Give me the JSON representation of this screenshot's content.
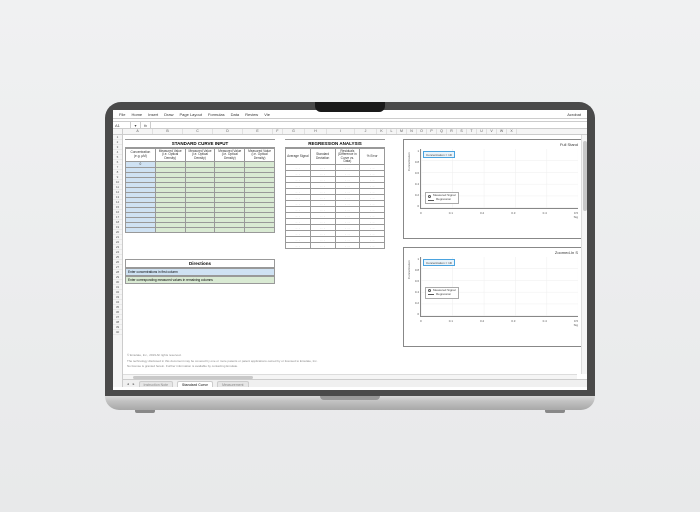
{
  "ribbon": {
    "tabs": [
      "File",
      "Home",
      "Insert",
      "Draw",
      "Page Layout",
      "Formulas",
      "Data",
      "Review",
      "Vie"
    ],
    "right": "Acrobat"
  },
  "formula_bar": {
    "name_box": "A1",
    "fx": "fx",
    "value": ""
  },
  "column_letters": [
    "A",
    "B",
    "C",
    "D",
    "E",
    "F",
    "G",
    "H",
    "I",
    "J",
    "K",
    "L",
    "M",
    "N",
    "O",
    "P",
    "Q",
    "R",
    "S",
    "T",
    "U",
    "V",
    "W",
    "X"
  ],
  "row_count": 40,
  "standard_curve": {
    "title": "STANDARD CURVE INPUT",
    "headers": [
      "Concentration (e.g. µM)",
      "Measured Value (i.e. Optical Density)",
      "Measured Value (i.e. Optical Density)",
      "Measured Value (i.e. Optical Density)",
      "Measured Value (i.e. Optical Density)"
    ],
    "first_cell": "0",
    "data_rows": 14
  },
  "regression": {
    "title": "REGRESSION ANALYSIS",
    "headers": [
      "Average Signal",
      "Standard Deviation",
      "Residuals (Difference in Curve vs. Data)",
      "% Error"
    ],
    "data_rows": 14
  },
  "directions": {
    "title": "Directions",
    "row1": "Enter concentrations in first column",
    "row2": "Enter corresponding measured values in remaining columns"
  },
  "chart_data": [
    {
      "type": "scatter",
      "title": "Full Stand",
      "annotation": "Concentration = 1D",
      "ylabel": "Concentration",
      "xlabel": "Sig",
      "series": [
        {
          "name": "Measured Signal",
          "x": [],
          "y": []
        },
        {
          "name": "Regression",
          "x": [],
          "y": []
        }
      ],
      "xticks": [
        "0",
        "0.1",
        "0.2",
        "0.3",
        "0.4",
        "0.5"
      ],
      "yticks": [
        "0",
        "0.2",
        "0.4",
        "0.6",
        "0.8",
        "1"
      ],
      "legend_position": "inside-bottom-left"
    },
    {
      "type": "scatter",
      "title": "Zoomed-In S",
      "annotation": "Concentration = 1D",
      "ylabel": "Concentration",
      "xlabel": "Sig",
      "series": [
        {
          "name": "Measured Signal",
          "x": [],
          "y": []
        },
        {
          "name": "Regression",
          "x": [],
          "y": []
        }
      ],
      "xticks": [
        "0",
        "0.1",
        "0.2",
        "0.3",
        "0.4",
        "0.5"
      ],
      "yticks": [
        "0",
        "0.2",
        "0.4",
        "0.6",
        "0.8",
        "1"
      ],
      "legend_position": "inside-center-left"
    }
  ],
  "footer": {
    "line1": "© Emulate, Inc., 2019    All rights reserved.",
    "line2": "The technology disclosed in this document may be covered by one or more patents or patent applications owned by or licensed to Emulate, Inc.",
    "line3": "No license is granted herein. Further information is available by contacting Emulate."
  },
  "sheet_tabs": {
    "tabs": [
      "Instruction Note",
      "Standard Curve",
      "Measurement"
    ],
    "active_index": 1
  }
}
